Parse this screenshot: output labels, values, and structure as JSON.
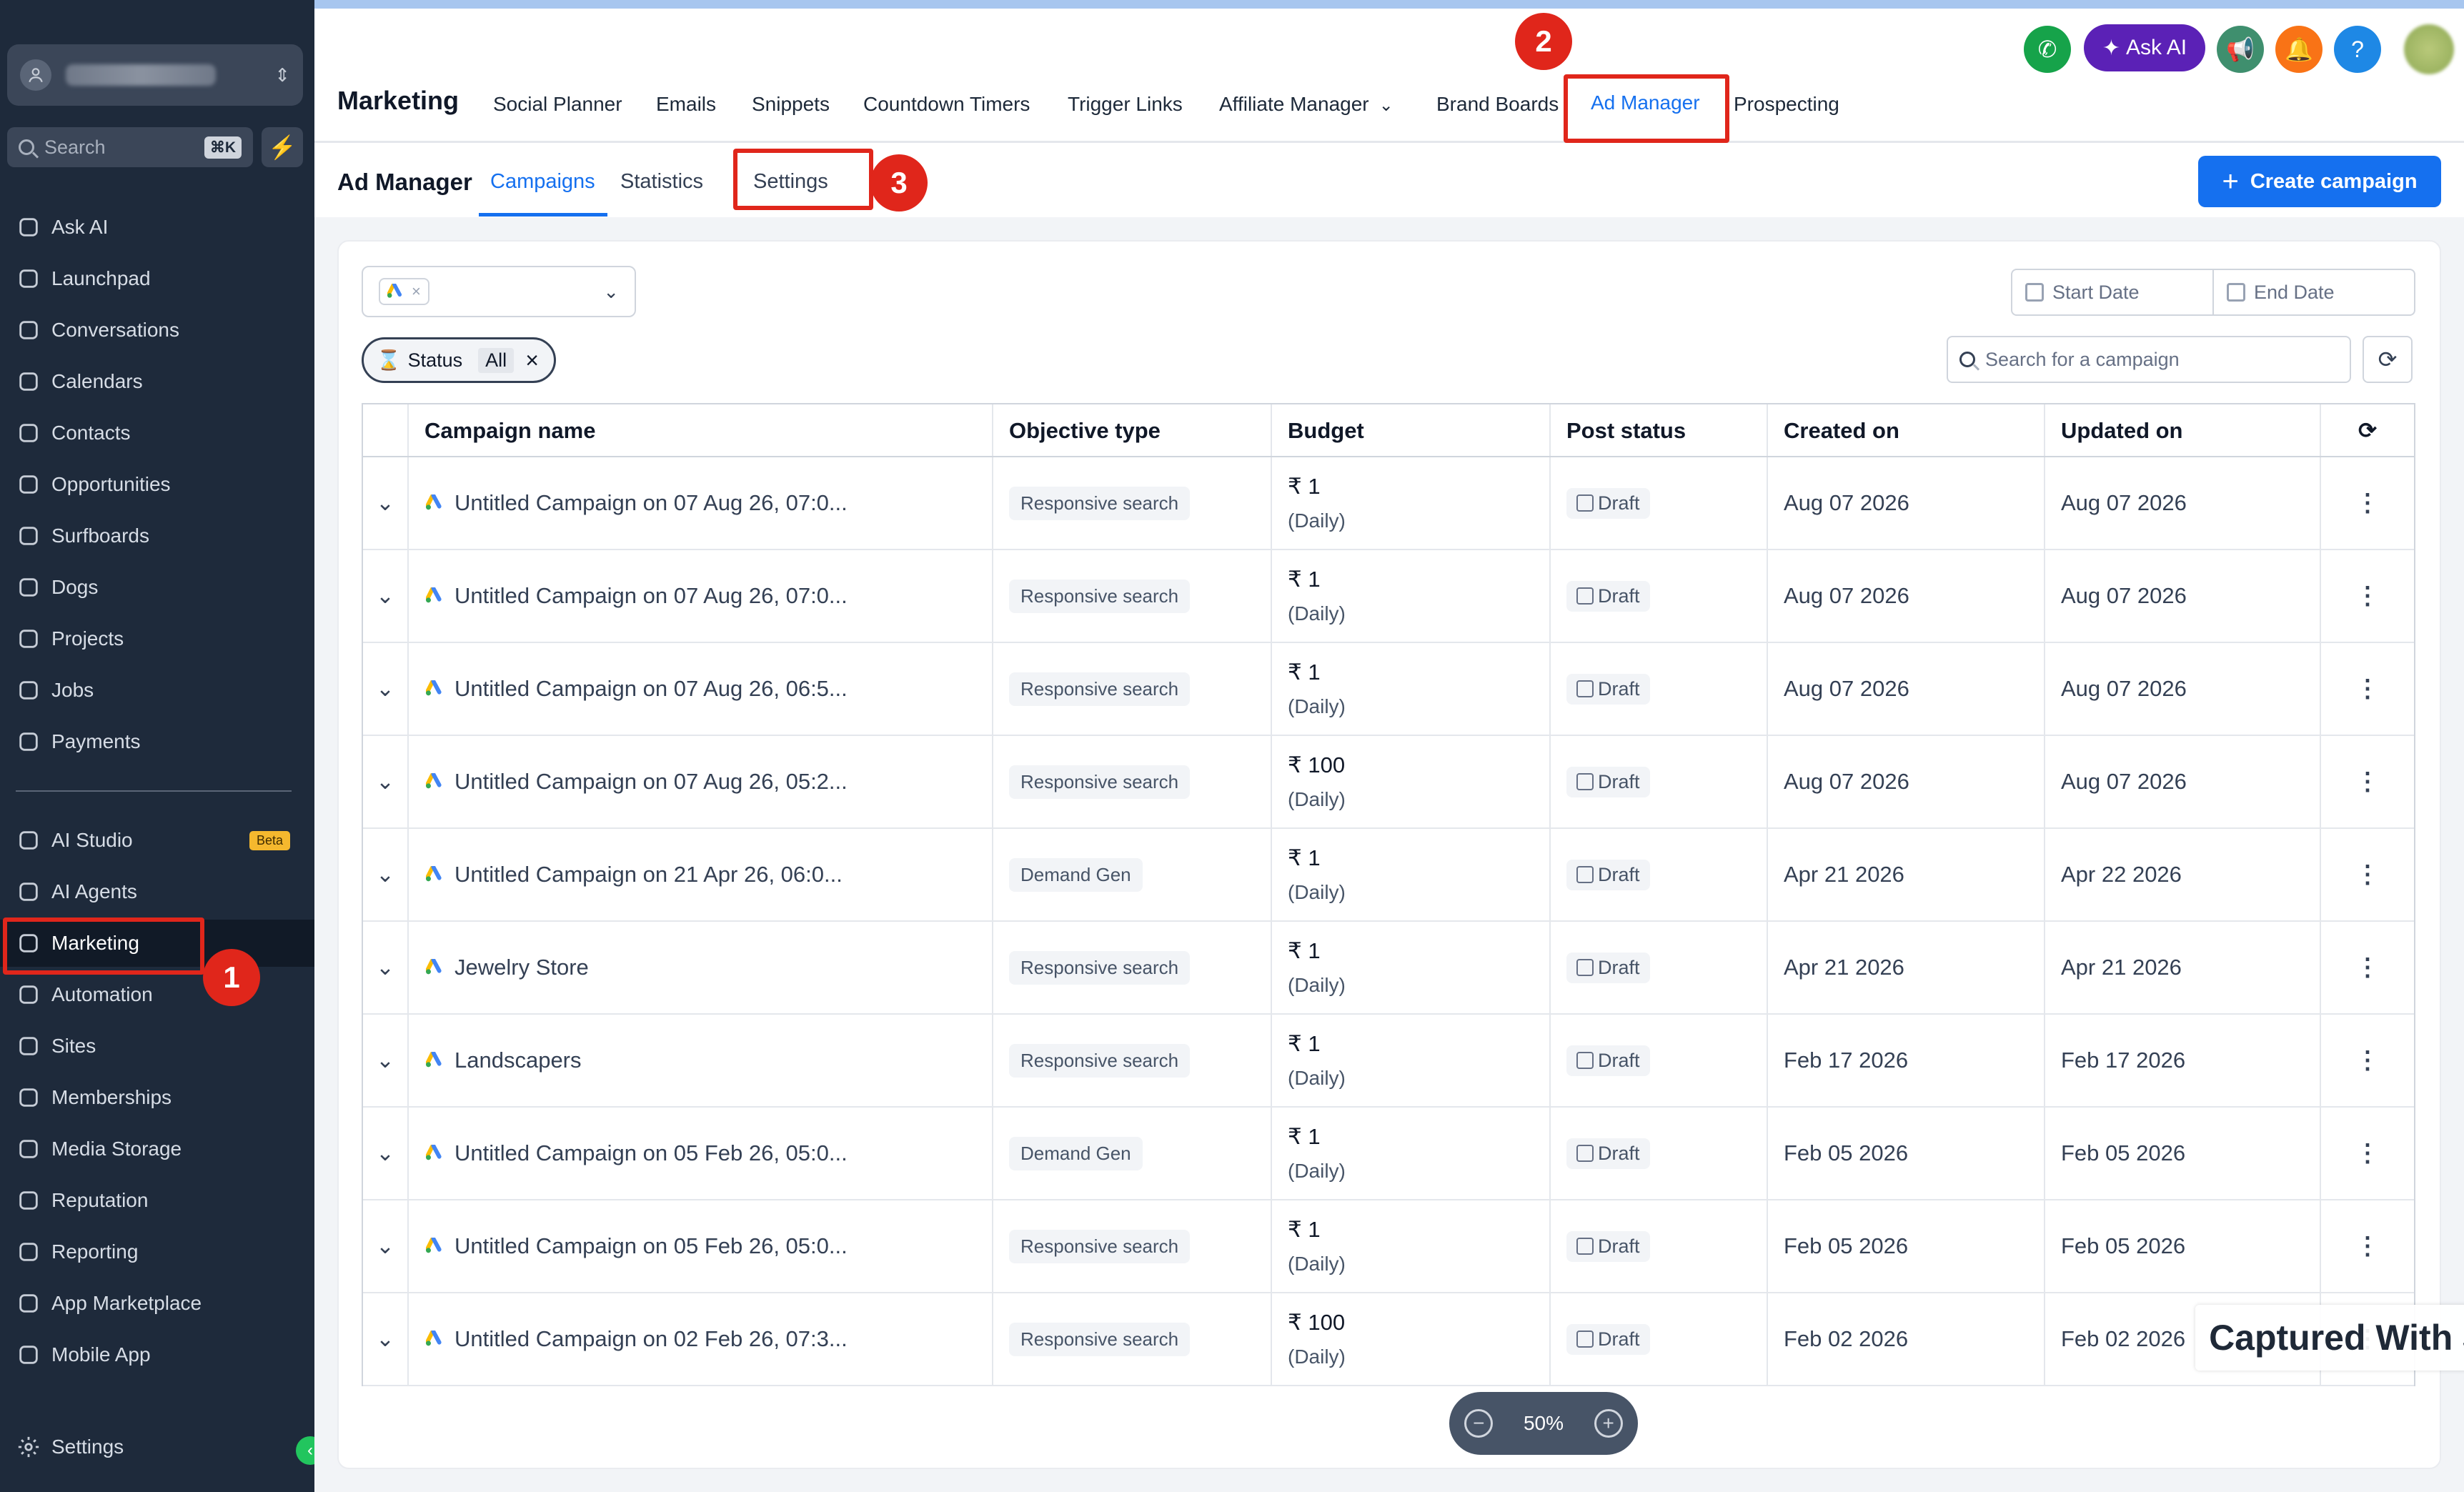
{
  "sidebar": {
    "search": {
      "placeholder": "Search",
      "shortcut": "⌘K"
    },
    "items": [
      {
        "label": "Ask AI",
        "icon": "sparkle-icon"
      },
      {
        "label": "Launchpad",
        "icon": "rocket-icon"
      },
      {
        "label": "Conversations",
        "icon": "chat-bubble-icon"
      },
      {
        "label": "Calendars",
        "icon": "calendar-icon"
      },
      {
        "label": "Contacts",
        "icon": "contacts-icon"
      },
      {
        "label": "Opportunities",
        "icon": "network-icon"
      },
      {
        "label": "Surfboards",
        "icon": "surfboard-icon"
      },
      {
        "label": "Dogs",
        "icon": "paw-icon"
      },
      {
        "label": "Projects",
        "icon": "clipboard-icon"
      },
      {
        "label": "Jobs",
        "icon": "tools-icon"
      },
      {
        "label": "Payments",
        "icon": "receipt-icon"
      },
      {
        "label": "AI Studio",
        "icon": "ai-studio-icon",
        "badge": "Beta"
      },
      {
        "label": "AI Agents",
        "icon": "agent-icon"
      },
      {
        "label": "Marketing",
        "icon": "paper-plane-icon",
        "active": true
      },
      {
        "label": "Automation",
        "icon": "automation-icon"
      },
      {
        "label": "Sites",
        "icon": "sites-icon"
      },
      {
        "label": "Memberships",
        "icon": "membership-icon"
      },
      {
        "label": "Media Storage",
        "icon": "image-icon"
      },
      {
        "label": "Reputation",
        "icon": "star-icon"
      },
      {
        "label": "Reporting",
        "icon": "trend-icon"
      },
      {
        "label": "App Marketplace",
        "icon": "grid-icon"
      },
      {
        "label": "Mobile App",
        "icon": "phone-icon"
      }
    ],
    "settings_label": "Settings"
  },
  "header": {
    "title": "Marketing",
    "tabs": [
      "Social Planner",
      "Emails",
      "Snippets",
      "Countdown Timers",
      "Trigger Links",
      "Affiliate Manager",
      "Brand Boards",
      "Ad Manager",
      "Prospecting"
    ],
    "active_tab": "Ad Manager",
    "ask_ai_label": "Ask AI",
    "help_label": "?"
  },
  "subheader": {
    "title": "Ad Manager",
    "tabs": [
      "Campaigns",
      "Statistics",
      "Settings"
    ],
    "active_tab": "Campaigns",
    "create_button": "Create campaign"
  },
  "filters": {
    "start_date_placeholder": "Start Date",
    "end_date_placeholder": "End Date",
    "status_label": "Status",
    "status_value": "All",
    "search_placeholder": "Search for a campaign"
  },
  "table": {
    "columns": [
      "Campaign name",
      "Objective type",
      "Budget",
      "Post status",
      "Created on",
      "Updated on"
    ],
    "rows": [
      {
        "name": "Untitled Campaign on 07 Aug 26, 07:0...",
        "objective": "Responsive search",
        "budget": "₹ 1",
        "period": "(Daily)",
        "status": "Draft",
        "created": "Aug 07 2026",
        "updated": "Aug 07 2026"
      },
      {
        "name": "Untitled Campaign on 07 Aug 26, 07:0...",
        "objective": "Responsive search",
        "budget": "₹ 1",
        "period": "(Daily)",
        "status": "Draft",
        "created": "Aug 07 2026",
        "updated": "Aug 07 2026"
      },
      {
        "name": "Untitled Campaign on 07 Aug 26, 06:5...",
        "objective": "Responsive search",
        "budget": "₹ 1",
        "period": "(Daily)",
        "status": "Draft",
        "created": "Aug 07 2026",
        "updated": "Aug 07 2026"
      },
      {
        "name": "Untitled Campaign on 07 Aug 26, 05:2...",
        "objective": "Responsive search",
        "budget": "₹ 100",
        "period": "(Daily)",
        "status": "Draft",
        "created": "Aug 07 2026",
        "updated": "Aug 07 2026"
      },
      {
        "name": "Untitled Campaign on 21 Apr 26, 06:0...",
        "objective": "Demand Gen",
        "budget": "₹ 1",
        "period": "(Daily)",
        "status": "Draft",
        "created": "Apr 21 2026",
        "updated": "Apr 22 2026"
      },
      {
        "name": "Jewelry Store",
        "objective": "Responsive search",
        "budget": "₹ 1",
        "period": "(Daily)",
        "status": "Draft",
        "created": "Apr 21 2026",
        "updated": "Apr 21 2026"
      },
      {
        "name": "Landscapers",
        "objective": "Responsive search",
        "budget": "₹ 1",
        "period": "(Daily)",
        "status": "Draft",
        "created": "Feb 17 2026",
        "updated": "Feb 17 2026"
      },
      {
        "name": "Untitled Campaign on 05 Feb 26, 05:0...",
        "objective": "Demand Gen",
        "budget": "₹ 1",
        "period": "(Daily)",
        "status": "Draft",
        "created": "Feb 05 2026",
        "updated": "Feb 05 2026"
      },
      {
        "name": "Untitled Campaign on 05 Feb 26, 05:0...",
        "objective": "Responsive search",
        "budget": "₹ 1",
        "period": "(Daily)",
        "status": "Draft",
        "created": "Feb 05 2026",
        "updated": "Feb 05 2026"
      },
      {
        "name": "Untitled Campaign on 02 Feb 26, 07:3...",
        "objective": "Responsive search",
        "budget": "₹ 100",
        "period": "(Daily)",
        "status": "Draft",
        "created": "Feb 02 2026",
        "updated": "Feb 02 2026"
      }
    ]
  },
  "annotations": [
    "1",
    "2",
    "3"
  ],
  "watermark": "Captured With Jumpshare",
  "zoom": "50%",
  "colors": {
    "accent": "#1570ef",
    "sidebar": "#1e2a3b",
    "highlight": "#e0261b"
  }
}
